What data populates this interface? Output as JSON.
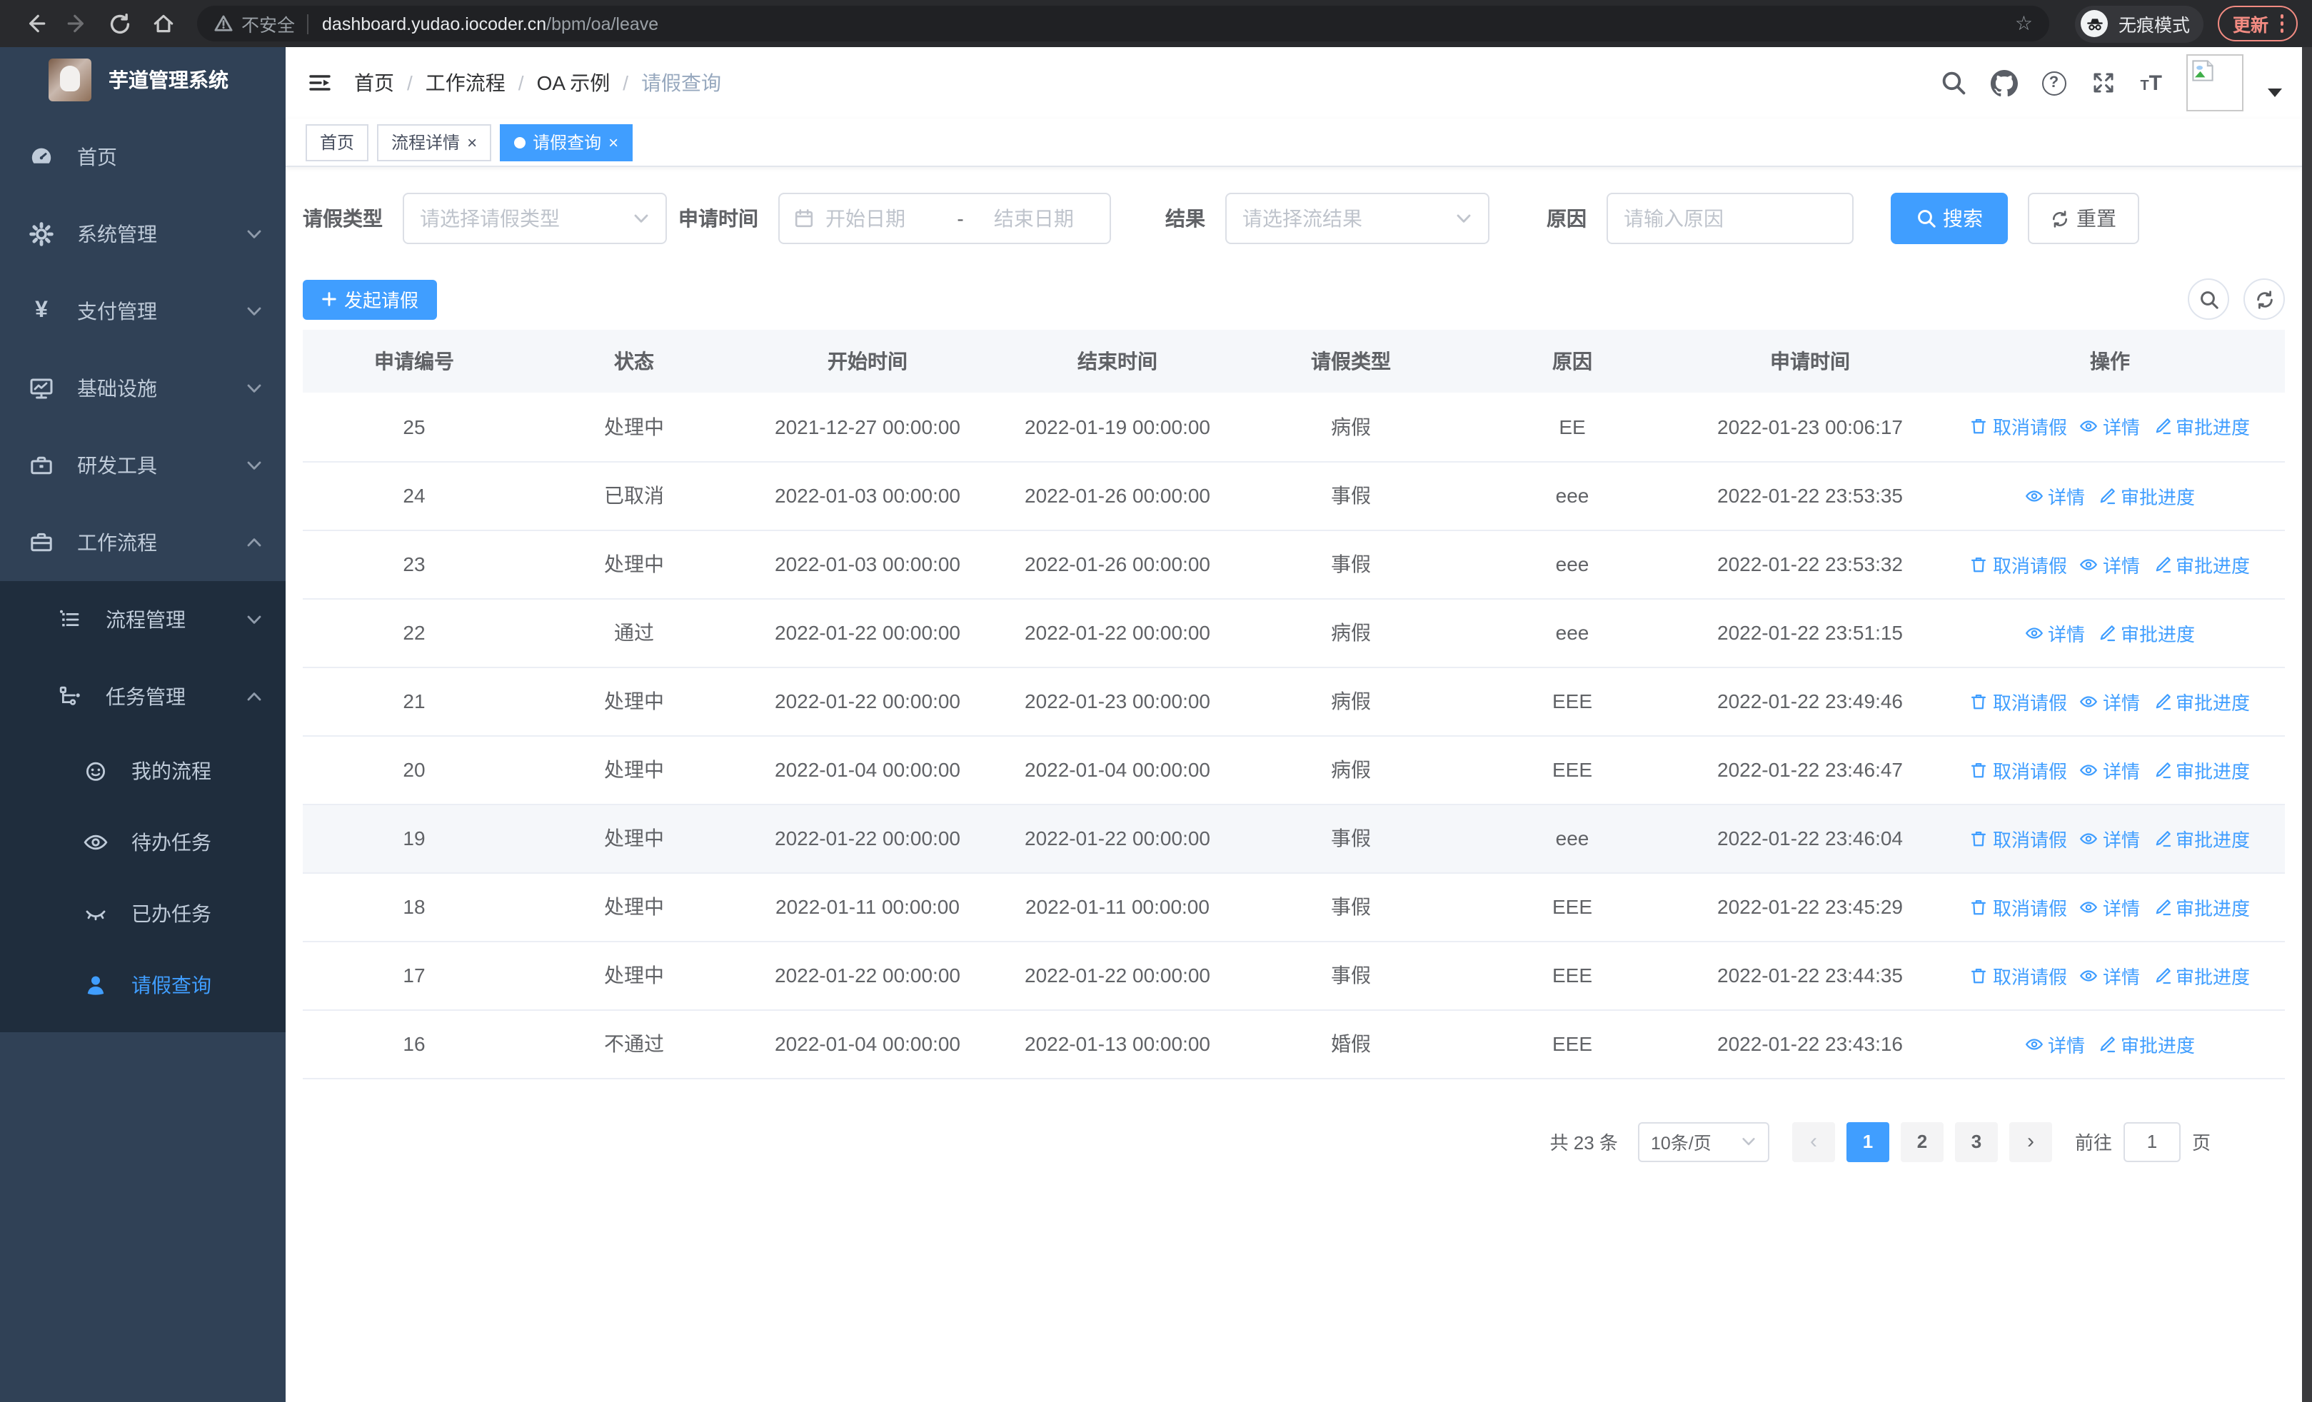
{
  "browser": {
    "security_label": "不安全",
    "url_domain": "dashboard.yudao.iocoder.cn",
    "url_path": "/bpm/oa/leave",
    "incognito_label": "无痕模式",
    "update_label": "更新"
  },
  "colors": {
    "accent": "#409eff",
    "sidebar_bg": "#304156",
    "submenu_bg": "#1f2d3d",
    "update_red": "#f28b82"
  },
  "sidebar": {
    "title": "芋道管理系统",
    "items": [
      {
        "label": "首页",
        "icon": "dashboard-icon"
      },
      {
        "label": "系统管理",
        "icon": "gear-icon"
      },
      {
        "label": "支付管理",
        "icon": "yen-icon"
      },
      {
        "label": "基础设施",
        "icon": "monitor-icon"
      },
      {
        "label": "研发工具",
        "icon": "toolbox-icon"
      },
      {
        "label": "工作流程",
        "icon": "briefcase-icon"
      },
      {
        "label": "流程管理",
        "icon": "list-tree-icon"
      },
      {
        "label": "任务管理",
        "icon": "flow-icon"
      },
      {
        "label": "我的流程",
        "icon": "face-icon"
      },
      {
        "label": "待办任务",
        "icon": "eye-icon"
      },
      {
        "label": "已办任务",
        "icon": "eye-closed-icon"
      },
      {
        "label": "请假查询",
        "icon": "user-icon"
      }
    ]
  },
  "header": {
    "breadcrumb": [
      "首页",
      "工作流程",
      "OA 示例",
      "请假查询"
    ],
    "separator": "/"
  },
  "tabs": [
    {
      "label": "首页"
    },
    {
      "label": "流程详情",
      "close": "×"
    },
    {
      "label": "请假查询",
      "close": "×"
    }
  ],
  "filters": {
    "leave_type": {
      "label": "请假类型",
      "placeholder": "请选择请假类型"
    },
    "apply_time": {
      "label": "申请时间",
      "start_placeholder": "开始日期",
      "separator": "-",
      "end_placeholder": "结束日期"
    },
    "result": {
      "label": "结果",
      "placeholder": "请选择流结果"
    },
    "reason": {
      "label": "原因",
      "placeholder": "请输入原因"
    },
    "search_label": "搜索",
    "reset_label": "重置"
  },
  "toolbar": {
    "create_label": "发起请假"
  },
  "table": {
    "columns": [
      "申请编号",
      "状态",
      "开始时间",
      "结束时间",
      "请假类型",
      "原因",
      "申请时间",
      "操作"
    ],
    "actions": {
      "cancel": "取消请假",
      "detail": "详情",
      "progress": "审批进度"
    },
    "rows": [
      {
        "id": "25",
        "status": "处理中",
        "start": "2021-12-27 00:00:00",
        "end": "2022-01-19 00:00:00",
        "type": "病假",
        "reason": "EE",
        "apply_time": "2022-01-23 00:06:17",
        "has_cancel": true
      },
      {
        "id": "24",
        "status": "已取消",
        "start": "2022-01-03 00:00:00",
        "end": "2022-01-26 00:00:00",
        "type": "事假",
        "reason": "eee",
        "apply_time": "2022-01-22 23:53:35",
        "has_cancel": false
      },
      {
        "id": "23",
        "status": "处理中",
        "start": "2022-01-03 00:00:00",
        "end": "2022-01-26 00:00:00",
        "type": "事假",
        "reason": "eee",
        "apply_time": "2022-01-22 23:53:32",
        "has_cancel": true
      },
      {
        "id": "22",
        "status": "通过",
        "start": "2022-01-22 00:00:00",
        "end": "2022-01-22 00:00:00",
        "type": "病假",
        "reason": "eee",
        "apply_time": "2022-01-22 23:51:15",
        "has_cancel": false
      },
      {
        "id": "21",
        "status": "处理中",
        "start": "2022-01-22 00:00:00",
        "end": "2022-01-23 00:00:00",
        "type": "病假",
        "reason": "EEE",
        "apply_time": "2022-01-22 23:49:46",
        "has_cancel": true
      },
      {
        "id": "20",
        "status": "处理中",
        "start": "2022-01-04 00:00:00",
        "end": "2022-01-04 00:00:00",
        "type": "病假",
        "reason": "EEE",
        "apply_time": "2022-01-22 23:46:47",
        "has_cancel": true
      },
      {
        "id": "19",
        "status": "处理中",
        "start": "2022-01-22 00:00:00",
        "end": "2022-01-22 00:00:00",
        "type": "事假",
        "reason": "eee",
        "apply_time": "2022-01-22 23:46:04",
        "has_cancel": true
      },
      {
        "id": "18",
        "status": "处理中",
        "start": "2022-01-11 00:00:00",
        "end": "2022-01-11 00:00:00",
        "type": "事假",
        "reason": "EEE",
        "apply_time": "2022-01-22 23:45:29",
        "has_cancel": true
      },
      {
        "id": "17",
        "status": "处理中",
        "start": "2022-01-22 00:00:00",
        "end": "2022-01-22 00:00:00",
        "type": "事假",
        "reason": "EEE",
        "apply_time": "2022-01-22 23:44:35",
        "has_cancel": true
      },
      {
        "id": "16",
        "status": "不通过",
        "start": "2022-01-04 00:00:00",
        "end": "2022-01-13 00:00:00",
        "type": "婚假",
        "reason": "EEE",
        "apply_time": "2022-01-22 23:43:16",
        "has_cancel": false
      }
    ]
  },
  "pagination": {
    "total_text": "共 23 条",
    "page_size": "10条/页",
    "prev": "‹",
    "next": "›",
    "pages": [
      "1",
      "2",
      "3"
    ],
    "goto_label": "前往",
    "goto_value": "1",
    "goto_suffix": "页"
  }
}
